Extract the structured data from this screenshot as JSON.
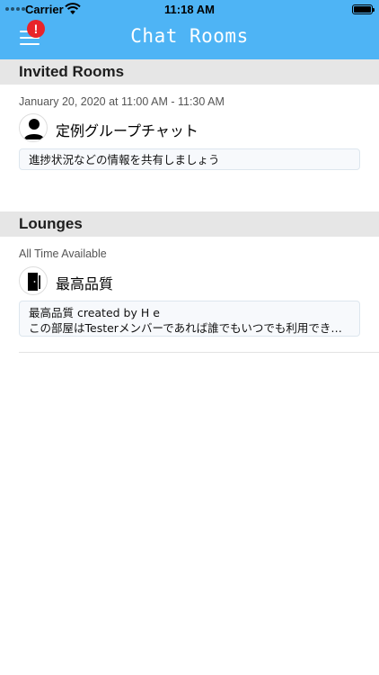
{
  "status_bar": {
    "carrier": "Carrier",
    "time": "11:18 AM"
  },
  "nav": {
    "title": "Chat Rooms",
    "badge": "!",
    "menu_icon": "hamburger-menu-icon"
  },
  "sections": {
    "invited": {
      "header": "Invited Rooms",
      "room": {
        "schedule": "January 20, 2020 at 11:00 AM - 11:30 AM",
        "name": "定例グループチャット",
        "description": "進捗状況などの情報を共有しましょう",
        "icon": "person-avatar-icon"
      }
    },
    "lounges": {
      "header": "Lounges",
      "room": {
        "availability": "All Time Available",
        "name": "最高品質",
        "description_line1": "最高品質 created by H  e",
        "description_line2": "この部屋はTesterメンバーであれば誰でもいつでも利用できます。",
        "icon": "door-icon"
      }
    }
  },
  "colors": {
    "nav_bar": "#4eb4f5",
    "badge": "#e8242a",
    "section_header": "#e6e6e6"
  }
}
